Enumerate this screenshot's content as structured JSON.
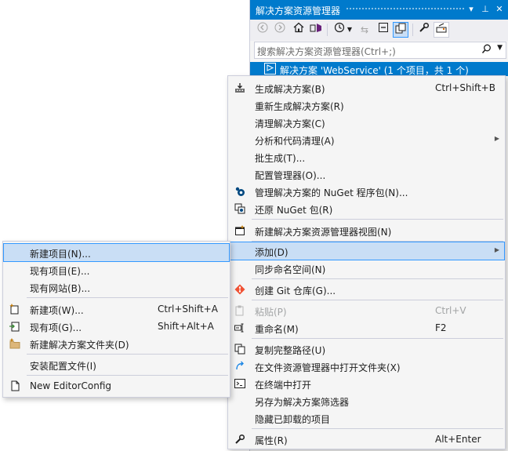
{
  "panel": {
    "title": "解决方案资源管理器",
    "title_buttons": [
      "▾",
      "⊥",
      "✕"
    ],
    "search_placeholder": "搜索解决方案资源管理器(Ctrl+;)",
    "solution_label": "解决方案 'WebService' (1 个项目，共 1 个)"
  },
  "context_menu": {
    "build": {
      "label": "生成解决方案(B)",
      "shortcut": "Ctrl+Shift+B"
    },
    "rebuild": {
      "label": "重新生成解决方案(R)"
    },
    "clean": {
      "label": "清理解决方案(C)"
    },
    "analyze": {
      "label": "分析和代码清理(A)"
    },
    "batch": {
      "label": "批生成(T)..."
    },
    "config": {
      "label": "配置管理器(O)..."
    },
    "nuget_manage": {
      "label": "管理解决方案的 NuGet 程序包(N)..."
    },
    "nuget_restore": {
      "label": "还原 NuGet 包(R)"
    },
    "new_view": {
      "label": "新建解决方案资源管理器视图(N)"
    },
    "add": {
      "label": "添加(D)"
    },
    "sync_ns": {
      "label": "同步命名空间(N)"
    },
    "git": {
      "label": "创建 Git 仓库(G)..."
    },
    "paste": {
      "label": "粘贴(P)",
      "shortcut": "Ctrl+V"
    },
    "rename": {
      "label": "重命名(M)",
      "shortcut": "F2"
    },
    "copy_path": {
      "label": "复制完整路径(U)"
    },
    "open_folder": {
      "label": "在文件资源管理器中打开文件夹(X)"
    },
    "open_terminal": {
      "label": "在终端中打开"
    },
    "save_filter": {
      "label": "另存为解决方案筛选器"
    },
    "hide_unloaded": {
      "label": "隐藏已卸载的项目"
    },
    "properties": {
      "label": "属性(R)",
      "shortcut": "Alt+Enter"
    }
  },
  "add_submenu": {
    "new_project": {
      "label": "新建项目(N)..."
    },
    "existing_project": {
      "label": "现有项目(E)..."
    },
    "existing_website": {
      "label": "现有网站(B)..."
    },
    "new_item": {
      "label": "新建项(W)...",
      "shortcut": "Ctrl+Shift+A"
    },
    "existing_item": {
      "label": "现有项(G)...",
      "shortcut": "Shift+Alt+A"
    },
    "new_folder": {
      "label": "新建解决方案文件夹(D)"
    },
    "install_config": {
      "label": "安装配置文件(I)"
    },
    "new_editorconfig": {
      "label": "New EditorConfig"
    }
  },
  "colors": {
    "accent": "#007acc",
    "highlight": "#c9def5",
    "highlight_border": "#3399ff",
    "menu_bg": "#f5f5f5"
  }
}
